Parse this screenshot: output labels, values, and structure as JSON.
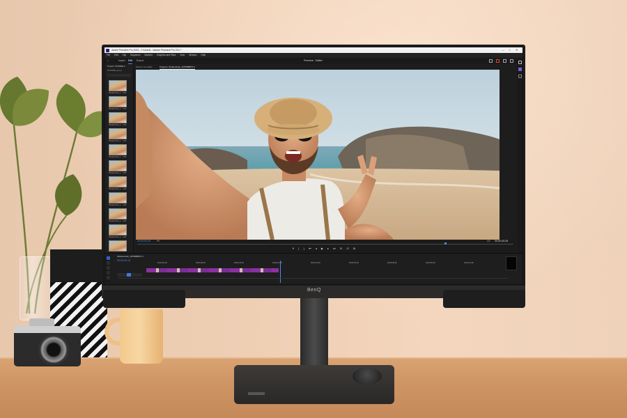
{
  "titlebar": {
    "text": "Adobe Premiere Pro 2023 - C:\\Users\\...\\Adobe Premiere Pro 23.0 *",
    "controls": [
      "—",
      "□",
      "✕"
    ]
  },
  "menu": [
    "File",
    "Edit",
    "Clip",
    "Sequence",
    "Markers",
    "Graphics and Titles",
    "View",
    "Window",
    "Help"
  ],
  "workspace": {
    "tabs": [
      "Import",
      "Edit",
      "Export"
    ],
    "active": "Edit",
    "title": "Premiere · Edited"
  },
  "project_panel": {
    "header": "Project: PICNIBE ≡",
    "subheader": "PICNIBE.prproj",
    "clip_label": "Shutterstock_1...  4:00"
  },
  "source_tabs": [
    "Source: (no clips)",
    "Program: Shutterstock_1075688872 ≡"
  ],
  "program_controls": {
    "timecode_in": "00;00;00;19",
    "fit": "Fit",
    "quality": "1/2",
    "timecode_out": "00;00;40;28",
    "transport": "⏵ { } ⏮ ◂ ▶ ▸ ⏭ ⊟ ⊡ ⊞"
  },
  "timeline": {
    "sequence_tab": "Shutterstock_1075688872 ≡",
    "timecode": "00;00;00;19",
    "ruler": [
      "00;00;00;00",
      "00;00;08;00",
      "00;00;16;00",
      "00;00;24;00",
      "00;00;32;00",
      "00;00;40;00",
      "00;00;48;00",
      "00;00;56;00",
      "00;01;04;00"
    ]
  },
  "brand": "BenQ",
  "colors": {
    "accent": "#4c8cf5",
    "clip": "#8c2fa0"
  }
}
